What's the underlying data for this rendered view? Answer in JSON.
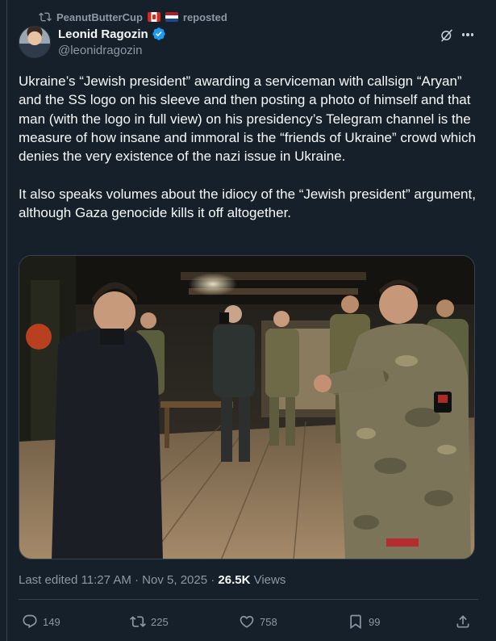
{
  "repost": {
    "user": "PeanutButterCup",
    "flags": [
      "Canada flag",
      "Netherlands flag"
    ],
    "label": "reposted"
  },
  "author": {
    "display_name": "Leonid Ragozin",
    "handle": "@leonidragozin",
    "verified": true
  },
  "tweet": {
    "text": "Ukraine’s “Jewish president” awarding a serviceman with callsign “Aryan” and the SS logo on his sleeve and then posting a photo of himself and that man (with the logo in full view) on his presidency’s Telegram channel is the measure of how insane and immoral is the “friends of Ukraine” crowd which denies the very existence of the nazi issue in Ukraine.\n\nIt also speaks volumes about the idiocy of the “Jewish president” argument, although Gaza genocide kills it off altogether."
  },
  "meta": {
    "edited_label": "Last edited",
    "time": "11:27 AM",
    "separator": " · ",
    "date": "Nov 5, 2025",
    "views_count": "26.5K",
    "views_label": "Views"
  },
  "actions": {
    "replies": "149",
    "reposts": "225",
    "likes": "758",
    "bookmarks": "99"
  },
  "icons": {
    "repost": "repost-icon",
    "verified": "verified-badge-icon",
    "grok": "grok-icon",
    "more": "more-icon",
    "reply": "reply-icon",
    "like": "heart-icon",
    "bookmark": "bookmark-icon",
    "share": "share-icon"
  },
  "colors": {
    "background": "#15202b",
    "text": "#f7f9f9",
    "secondary": "#8b98a5",
    "border": "#38444d",
    "verified": "#1d9bf0"
  }
}
